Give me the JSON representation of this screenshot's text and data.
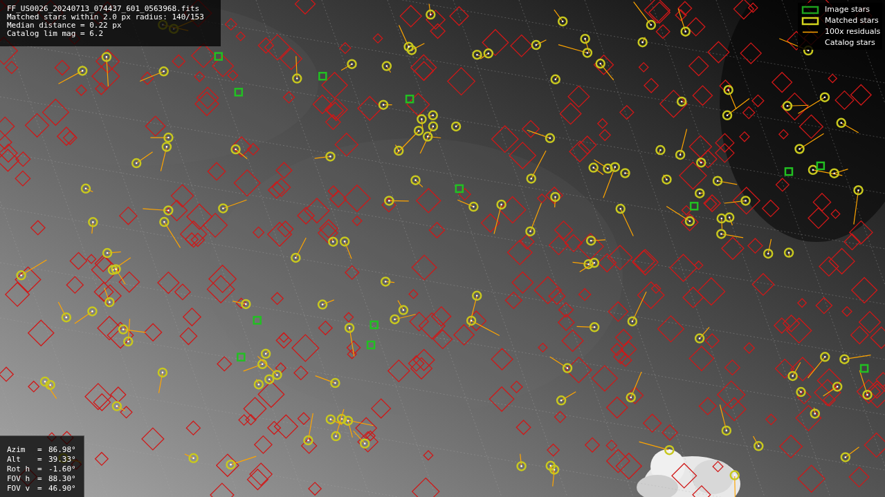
{
  "info_lines": [
    "FF_US0026_20240713_074437_601_0563968.fits",
    "Matched stars within 2.0 px radius: 140/153",
    "Median distance = 0.22 px",
    "Catalog lim mag = 6.2"
  ],
  "legend": [
    {
      "label": "Image stars"
    },
    {
      "kind": "matched",
      "label": "Matched stars"
    },
    {
      "kind": "residual",
      "label": "100x residuals"
    },
    {
      "kind": "catalog",
      "label": "Catalog stars"
    }
  ],
  "pointing": [
    {
      "label": "Azim",
      "separator": "=",
      "value": "86.98°"
    },
    {
      "label": "Alt",
      "separator": "=",
      "value": "39.33°"
    },
    {
      "label": "Rot h",
      "separator": "=",
      "value": "-1.60°"
    },
    {
      "label": "FOV h",
      "separator": "=",
      "value": "88.30°"
    },
    {
      "label": "FOV v",
      "separator": "=",
      "value": "46.90°"
    }
  ]
}
